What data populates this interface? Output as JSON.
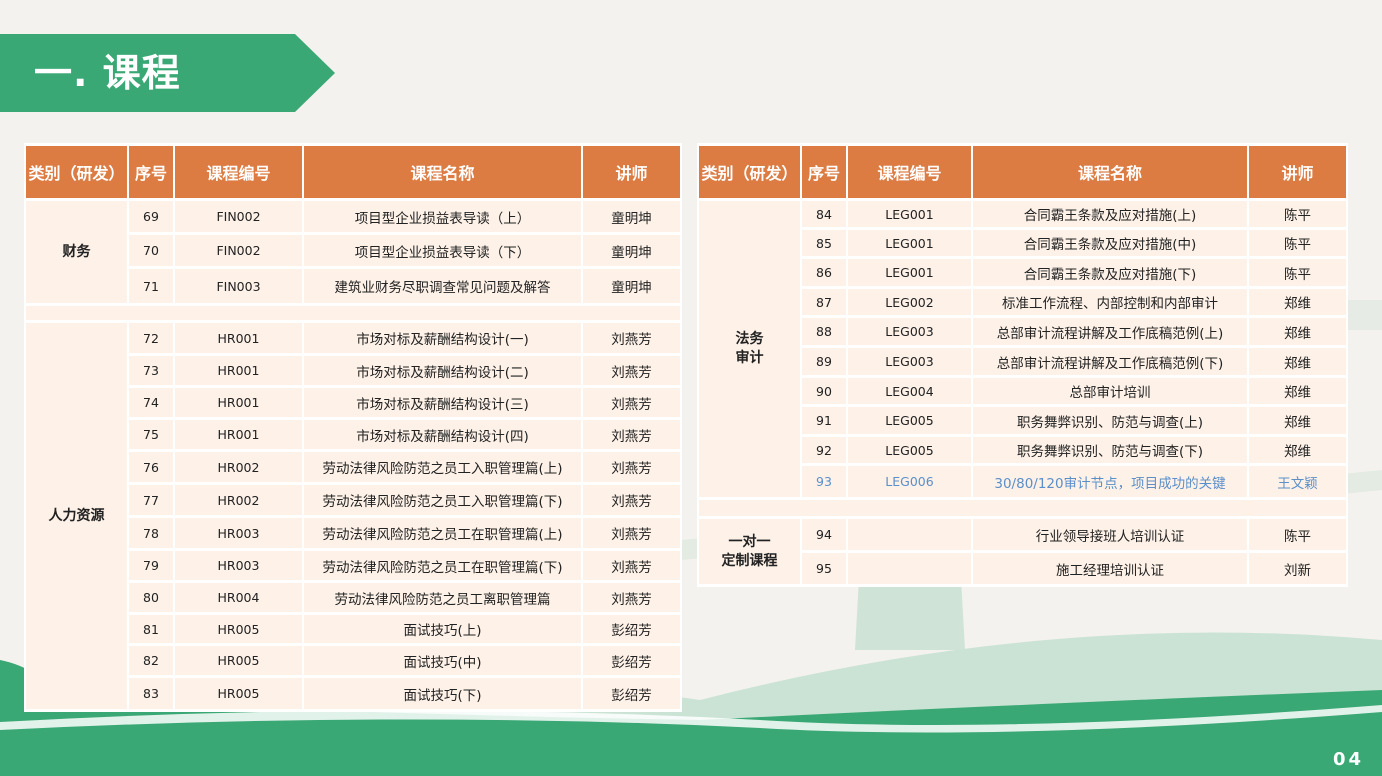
{
  "page": {
    "title": "一. 课程",
    "page_number": "04"
  },
  "colors": {
    "accent_green": "#3aa874",
    "header_orange": "#dc7b42",
    "cell_bg": "#fdf1e8",
    "highlight_blue": "#5b8fc9"
  },
  "table_headers": [
    "类别（研发）",
    "序号",
    "课程编号",
    "课程名称",
    "讲师"
  ],
  "left_table": {
    "groups": [
      {
        "category": "财务",
        "rows": [
          {
            "no": "69",
            "code": "FIN002",
            "name": "项目型企业损益表导读（上）",
            "teacher": "童明坤"
          },
          {
            "no": "70",
            "code": "FIN002",
            "name": "项目型企业损益表导读（下）",
            "teacher": "童明坤"
          },
          {
            "no": "71",
            "code": "FIN003",
            "name": "建筑业财务尽职调查常见问题及解答",
            "teacher": "童明坤"
          }
        ]
      },
      {
        "category": "人力资源",
        "rows": [
          {
            "no": "72",
            "code": "HR001",
            "name": "市场对标及薪酬结构设计(一)",
            "teacher": "刘燕芳"
          },
          {
            "no": "73",
            "code": "HR001",
            "name": "市场对标及薪酬结构设计(二)",
            "teacher": "刘燕芳"
          },
          {
            "no": "74",
            "code": "HR001",
            "name": "市场对标及薪酬结构设计(三)",
            "teacher": "刘燕芳"
          },
          {
            "no": "75",
            "code": "HR001",
            "name": "市场对标及薪酬结构设计(四)",
            "teacher": "刘燕芳"
          },
          {
            "no": "76",
            "code": "HR002",
            "name": "劳动法律风险防范之员工入职管理篇(上)",
            "teacher": "刘燕芳"
          },
          {
            "no": "77",
            "code": "HR002",
            "name": "劳动法律风险防范之员工入职管理篇(下)",
            "teacher": "刘燕芳"
          },
          {
            "no": "78",
            "code": "HR003",
            "name": "劳动法律风险防范之员工在职管理篇(上)",
            "teacher": "刘燕芳"
          },
          {
            "no": "79",
            "code": "HR003",
            "name": "劳动法律风险防范之员工在职管理篇(下)",
            "teacher": "刘燕芳"
          },
          {
            "no": "80",
            "code": "HR004",
            "name": "劳动法律风险防范之员工离职管理篇",
            "teacher": "刘燕芳"
          },
          {
            "no": "81",
            "code": "HR005",
            "name": "面试技巧(上)",
            "teacher": "彭绍芳"
          },
          {
            "no": "82",
            "code": "HR005",
            "name": "面试技巧(中)",
            "teacher": "彭绍芳"
          },
          {
            "no": "83",
            "code": "HR005",
            "name": "面试技巧(下)",
            "teacher": "彭绍芳"
          }
        ]
      }
    ]
  },
  "right_table": {
    "groups": [
      {
        "category_line1": "法务",
        "category_line2": "审计",
        "rows": [
          {
            "no": "84",
            "code": "LEG001",
            "name": "合同霸王条款及应对措施(上)",
            "teacher": "陈平"
          },
          {
            "no": "85",
            "code": "LEG001",
            "name": "合同霸王条款及应对措施(中)",
            "teacher": "陈平"
          },
          {
            "no": "86",
            "code": "LEG001",
            "name": "合同霸王条款及应对措施(下)",
            "teacher": "陈平"
          },
          {
            "no": "87",
            "code": "LEG002",
            "name": "标准工作流程、内部控制和内部审计",
            "teacher": "郑维"
          },
          {
            "no": "88",
            "code": "LEG003",
            "name": "总部审计流程讲解及工作底稿范例(上)",
            "teacher": "郑维"
          },
          {
            "no": "89",
            "code": "LEG003",
            "name": "总部审计流程讲解及工作底稿范例(下)",
            "teacher": "郑维"
          },
          {
            "no": "90",
            "code": "LEG004",
            "name": "总部审计培训",
            "teacher": "郑维"
          },
          {
            "no": "91",
            "code": "LEG005",
            "name": "职务舞弊识别、防范与调查(上)",
            "teacher": "郑维"
          },
          {
            "no": "92",
            "code": "LEG005",
            "name": "职务舞弊识别、防范与调查(下)",
            "teacher": "郑维"
          },
          {
            "no": "93",
            "code": "LEG006",
            "name": "30/80/120审计节点，项目成功的关键",
            "teacher": "王文颖"
          }
        ]
      },
      {
        "category_line1": "一对一",
        "category_line2": "定制课程",
        "rows": [
          {
            "no": "94",
            "code": "",
            "name": "行业领导接班人培训认证",
            "teacher": "陈平"
          },
          {
            "no": "95",
            "code": "",
            "name": "施工经理培训认证",
            "teacher": "刘新"
          }
        ]
      }
    ]
  }
}
